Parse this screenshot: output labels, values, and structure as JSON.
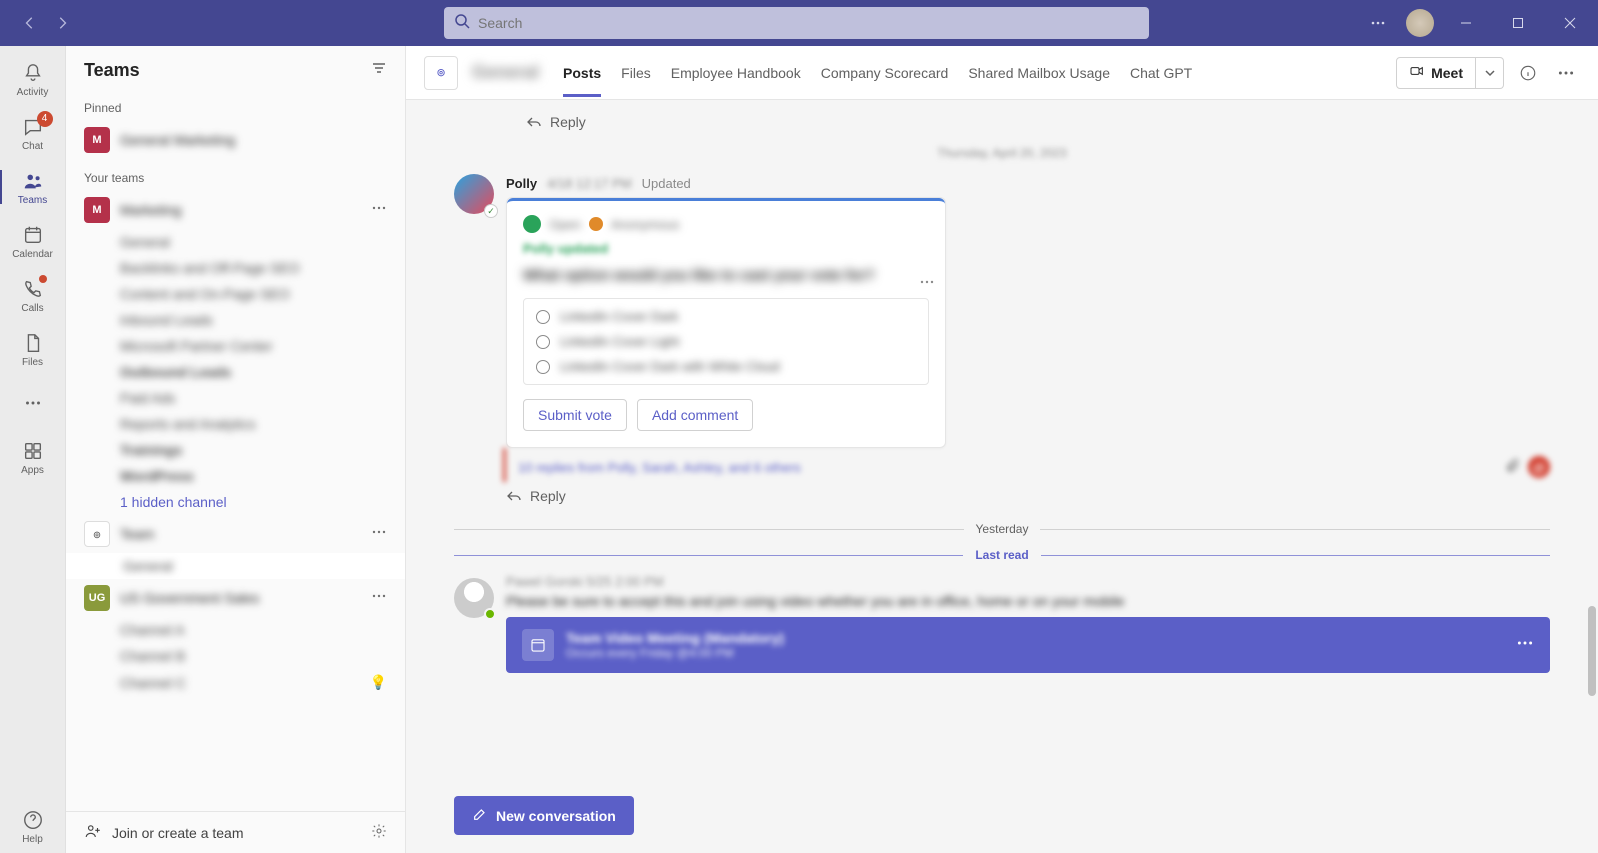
{
  "search": {
    "placeholder": "Search"
  },
  "rail": {
    "activity": "Activity",
    "chat": "Chat",
    "chat_badge": "4",
    "teams": "Teams",
    "calendar": "Calendar",
    "calls": "Calls",
    "files": "Files",
    "apps": "Apps",
    "help": "Help"
  },
  "panel": {
    "title": "Teams",
    "pinned_label": "Pinned",
    "pinned_team_initial": "M",
    "pinned_team_name": "General Marketing",
    "your_teams_label": "Your teams",
    "teams": [
      {
        "initial": "M",
        "color": "red",
        "name": "Marketing",
        "channels": [
          "General",
          "Backlinks and Off-Page SEO",
          "Content and On-Page SEO",
          "Inbound Leads",
          "Microsoft Partner Center",
          "Outbound Leads",
          "Paid Ads",
          "Reports and Analytics",
          "Trainings",
          "WordPress"
        ],
        "hidden_link": "1 hidden channel"
      },
      {
        "initial": "⬚",
        "color": "white",
        "name": "Team",
        "channels": [
          "General"
        ],
        "selected_channel_index": 0
      },
      {
        "initial": "UG",
        "color": "green",
        "name": "US Government Sales",
        "channels": [
          "Channel A",
          "Channel B",
          "Channel C"
        ],
        "lamp_on_index": 2
      }
    ],
    "join_create": "Join or create a team"
  },
  "header": {
    "channel_name": "General",
    "tabs": [
      "Posts",
      "Files",
      "Employee Handbook",
      "Company Scorecard",
      "Shared Mailbox Usage",
      "Chat GPT"
    ],
    "active_tab_index": 0,
    "meet": "Meet"
  },
  "posts": {
    "reply_label": "Reply",
    "date_separator_1": "Thursday, April 20, 2023",
    "yesterday_label": "Yesterday",
    "last_read_label": "Last read",
    "polly": {
      "author": "Polly",
      "time": "4/18 12:17 PM",
      "status": "Updated",
      "meta_open": "Open",
      "meta_anon": "Anonymous",
      "updated_line": "Polly updated",
      "question": "What option would you like to cast your vote for?",
      "options": [
        "LinkedIn Cover Dark",
        "LinkedIn Cover Light",
        "LinkedIn Cover Dark with White Cloud"
      ],
      "submit": "Submit vote",
      "add_comment": "Add comment",
      "replies_line": "10 replies from Polly, Sarah, Ashley, and 6 others"
    },
    "post2": {
      "author_line": "Pawel Gorski   5/25 2:00 PM",
      "text_line": "Please be sure to accept this and join using video whether you are in office, home or on your mobile",
      "meeting_title": "Team Video Meeting (Mandatory)",
      "meeting_sub": "Occurs every Friday @4:00 PM"
    },
    "new_conversation": "New conversation"
  }
}
